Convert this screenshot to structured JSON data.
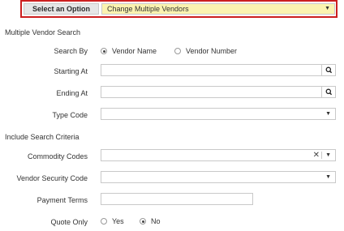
{
  "option_bar": {
    "label": "Select an Option",
    "selected": "Change Multiple Vendors"
  },
  "sections": {
    "vendor_search_title": "Multiple Vendor Search",
    "include_criteria_title": "Include Search Criteria"
  },
  "fields": {
    "search_by_label": "Search By",
    "search_by_options": [
      "Vendor Name",
      "Vendor Number"
    ],
    "search_by_selected": "Vendor Name",
    "starting_at_label": "Starting At",
    "starting_at_value": "",
    "ending_at_label": "Ending At",
    "ending_at_value": "",
    "type_code_label": "Type Code",
    "type_code_value": "",
    "commodity_codes_label": "Commodity Codes",
    "commodity_codes_value": "",
    "vendor_security_code_label": "Vendor Security Code",
    "vendor_security_code_value": "",
    "payment_terms_label": "Payment Terms",
    "payment_terms_value": "",
    "quote_only_label": "Quote Only",
    "quote_only_options": [
      "Yes",
      "No"
    ],
    "quote_only_selected": "No"
  },
  "colors": {
    "highlight_border": "#cc1f1f",
    "select_highlight": "#fbf3b0"
  }
}
